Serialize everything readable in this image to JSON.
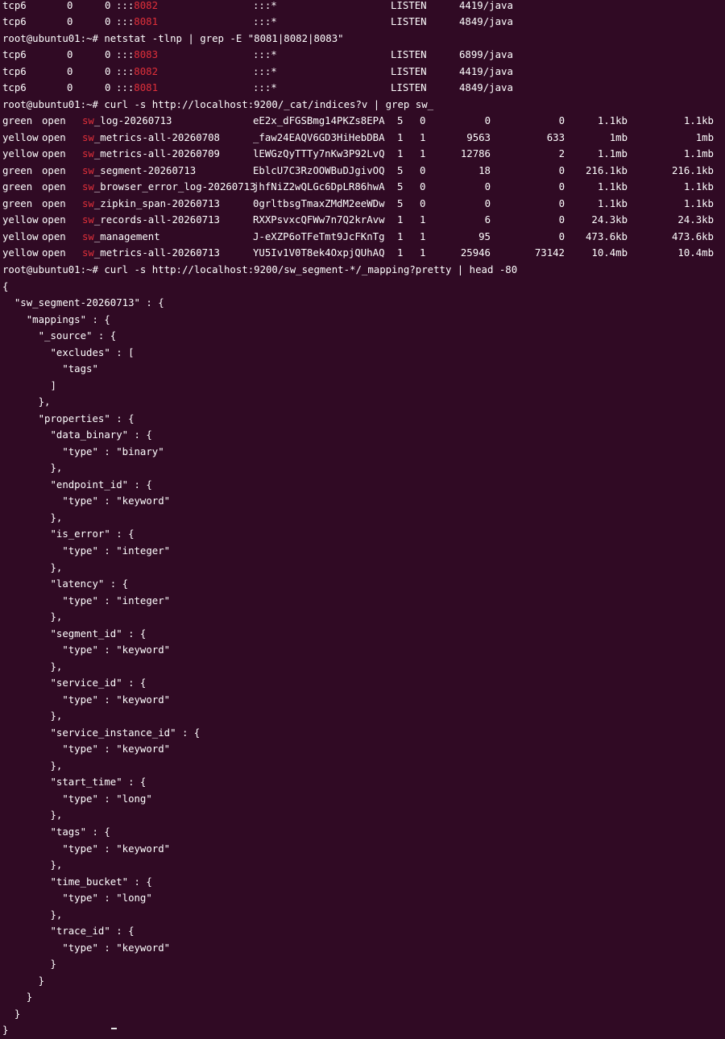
{
  "prompt": "root@ubuntu01:~#",
  "netstat_top": [
    {
      "proto": "tcp6",
      "recv": "0",
      "send": "0",
      "addr_prefix": ":::",
      "port": "8082",
      "foreign": ":::*",
      "state": "LISTEN",
      "pid": "4419/java"
    },
    {
      "proto": "tcp6",
      "recv": "0",
      "send": "0",
      "addr_prefix": ":::",
      "port": "8081",
      "foreign": ":::*",
      "state": "LISTEN",
      "pid": "4849/java"
    }
  ],
  "cmd_netstat": "netstat -tlnp | grep -E \"8081|8082|8083\"",
  "netstat": [
    {
      "proto": "tcp6",
      "recv": "0",
      "send": "0",
      "addr_prefix": ":::",
      "port": "8083",
      "foreign": ":::*",
      "state": "LISTEN",
      "pid": "6899/java"
    },
    {
      "proto": "tcp6",
      "recv": "0",
      "send": "0",
      "addr_prefix": ":::",
      "port": "8082",
      "foreign": ":::*",
      "state": "LISTEN",
      "pid": "4419/java"
    },
    {
      "proto": "tcp6",
      "recv": "0",
      "send": "0",
      "addr_prefix": ":::",
      "port": "8081",
      "foreign": ":::*",
      "state": "LISTEN",
      "pid": "4849/java"
    }
  ],
  "cmd_indices": "curl -s http://localhost:9200/_cat/indices?v | grep sw_",
  "indices": [
    {
      "health": "green",
      "status": "open",
      "prefix": "sw",
      "rest": "_log-20260713",
      "uuid": "eE2x_dFGSBmg14PKZs8EPA",
      "pri": "5",
      "rep": "0",
      "docs": "0",
      "deleted": "0",
      "size": "1.1kb",
      "pri_size": "1.1kb"
    },
    {
      "health": "yellow",
      "status": "open",
      "prefix": "sw",
      "rest": "_metrics-all-20260708",
      "uuid": "_faw24EAQV6GD3HiHebDBA",
      "pri": "1",
      "rep": "1",
      "docs": "9563",
      "deleted": "633",
      "size": "1mb",
      "pri_size": "1mb"
    },
    {
      "health": "yellow",
      "status": "open",
      "prefix": "sw",
      "rest": "_metrics-all-20260709",
      "uuid": "lEWGzQyTTTy7nKw3P92LvQ",
      "pri": "1",
      "rep": "1",
      "docs": "12786",
      "deleted": "2",
      "size": "1.1mb",
      "pri_size": "1.1mb"
    },
    {
      "health": "green",
      "status": "open",
      "prefix": "sw",
      "rest": "_segment-20260713",
      "uuid": "EblcU7C3RzOOWBuDJgivOQ",
      "pri": "5",
      "rep": "0",
      "docs": "18",
      "deleted": "0",
      "size": "216.1kb",
      "pri_size": "216.1kb"
    },
    {
      "health": "green",
      "status": "open",
      "prefix": "sw",
      "rest": "_browser_error_log-20260713",
      "uuid": "jhfNiZ2wQLGc6DpLR86hwA",
      "pri": "5",
      "rep": "0",
      "docs": "0",
      "deleted": "0",
      "size": "1.1kb",
      "pri_size": "1.1kb"
    },
    {
      "health": "green",
      "status": "open",
      "prefix": "sw",
      "rest": "_zipkin_span-20260713",
      "uuid": "0grltbsgTmaxZMdM2eeWDw",
      "pri": "5",
      "rep": "0",
      "docs": "0",
      "deleted": "0",
      "size": "1.1kb",
      "pri_size": "1.1kb"
    },
    {
      "health": "yellow",
      "status": "open",
      "prefix": "sw",
      "rest": "_records-all-20260713",
      "uuid": "RXXPsvxcQFWw7n7Q2krAvw",
      "pri": "1",
      "rep": "1",
      "docs": "6",
      "deleted": "0",
      "size": "24.3kb",
      "pri_size": "24.3kb"
    },
    {
      "health": "yellow",
      "status": "open",
      "prefix": "sw",
      "rest": "_management",
      "uuid": "J-eXZP6oTFeTmt9JcFKnTg",
      "pri": "1",
      "rep": "1",
      "docs": "95",
      "deleted": "0",
      "size": "473.6kb",
      "pri_size": "473.6kb"
    },
    {
      "health": "yellow",
      "status": "open",
      "prefix": "sw",
      "rest": "_metrics-all-20260713",
      "uuid": "YU5Iv1V0T8ek4OxpjQUhAQ",
      "pri": "1",
      "rep": "1",
      "docs": "25946",
      "deleted": "73142",
      "size": "10.4mb",
      "pri_size": "10.4mb"
    }
  ],
  "cmd_mapping": "curl -s http://localhost:9200/sw_segment-*/_mapping?pretty | head -80",
  "mapping_lines": [
    "{",
    "  \"sw_segment-20260713\" : {",
    "    \"mappings\" : {",
    "      \"_source\" : {",
    "        \"excludes\" : [",
    "          \"tags\"",
    "        ]",
    "      },",
    "      \"properties\" : {",
    "        \"data_binary\" : {",
    "          \"type\" : \"binary\"",
    "        },",
    "        \"endpoint_id\" : {",
    "          \"type\" : \"keyword\"",
    "        },",
    "        \"is_error\" : {",
    "          \"type\" : \"integer\"",
    "        },",
    "        \"latency\" : {",
    "          \"type\" : \"integer\"",
    "        },",
    "        \"segment_id\" : {",
    "          \"type\" : \"keyword\"",
    "        },",
    "        \"service_id\" : {",
    "          \"type\" : \"keyword\"",
    "        },",
    "        \"service_instance_id\" : {",
    "          \"type\" : \"keyword\"",
    "        },",
    "        \"start_time\" : {",
    "          \"type\" : \"long\"",
    "        },",
    "        \"tags\" : {",
    "          \"type\" : \"keyword\"",
    "        },",
    "        \"time_bucket\" : {",
    "          \"type\" : \"long\"",
    "        },",
    "        \"trace_id\" : {",
    "          \"type\" : \"keyword\"",
    "        }",
    "      }",
    "    }",
    "  }",
    "}"
  ],
  "colors": {
    "background": "#300a24",
    "text": "#ffffff",
    "highlight": "#e0303a"
  }
}
